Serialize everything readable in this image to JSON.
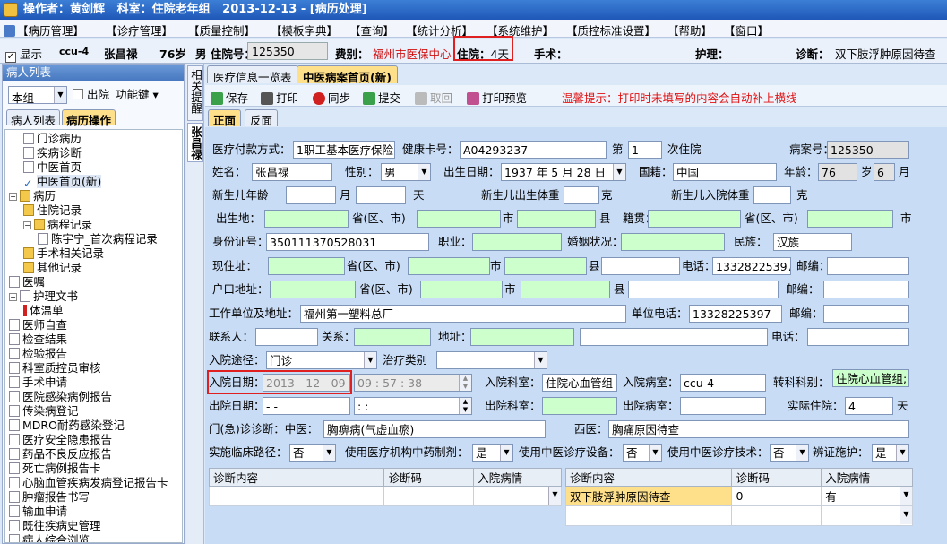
{
  "titlebar": {
    "text": "操作者：黄剑辉   科室：住院老年组   2013-12-13 - [病历处理]"
  },
  "menu": [
    "【病历管理】",
    "【诊疗管理】",
    "【质量控制】",
    "【模板字典】",
    "【查询】",
    "【统计分析】",
    "【系统维护】",
    "【质控标准设置】",
    "【帮助】",
    "【窗口】"
  ],
  "infobar": {
    "show_label": "显示",
    "bed": "ccu-4",
    "patient_name": "张昌禄",
    "age": "76岁",
    "gender_label": "男 住院号：",
    "inpatient_no": "125350",
    "fee_type_label": "费别：",
    "fee_type": "福州市医保中心",
    "stay_label": "住院：",
    "stay_days": "4天",
    "surgery_label": "手术：",
    "nursing_label": "护理：",
    "diagnosis_label": "诊断：",
    "diagnosis": "双下肢浮肿原因待查"
  },
  "left": {
    "header": "病人列表",
    "group": "本组",
    "discharge_label": "出院",
    "function_label": "功能键",
    "tabs": [
      "病人列表",
      "病历操作"
    ],
    "tree": [
      {
        "label": "门诊病历",
        "level": 1,
        "type": "doc"
      },
      {
        "label": "疾病诊断",
        "level": 1,
        "type": "doc"
      },
      {
        "label": "中医首页",
        "level": 1,
        "type": "doc"
      },
      {
        "label": "中医首页(新)",
        "level": 1,
        "type": "check"
      },
      {
        "label": "病历",
        "level": 0,
        "type": "folder",
        "pm": "−"
      },
      {
        "label": "住院记录",
        "level": 1,
        "type": "folder"
      },
      {
        "label": "病程记录",
        "level": 1,
        "type": "folder",
        "pm": "−"
      },
      {
        "label": "陈宇宁_首次病程记录",
        "level": 2,
        "type": "doc"
      },
      {
        "label": "手术相关记录",
        "level": 1,
        "type": "folder"
      },
      {
        "label": "其他记录",
        "level": 1,
        "type": "folder"
      },
      {
        "label": "医嘱",
        "level": 0,
        "type": "doc"
      },
      {
        "label": "护理文书",
        "level": 0,
        "type": "doc",
        "pm": "−"
      },
      {
        "label": "体温单",
        "level": 1,
        "type": "therm"
      },
      {
        "label": "医师自查",
        "level": 0,
        "type": "doc"
      },
      {
        "label": "检查结果",
        "level": 0,
        "type": "doc"
      },
      {
        "label": "检验报告",
        "level": 0,
        "type": "doc"
      },
      {
        "label": "科室质控员审核",
        "level": 0,
        "type": "doc"
      },
      {
        "label": "手术申请",
        "level": 0,
        "type": "doc"
      },
      {
        "label": "医院感染病例报告",
        "level": 0,
        "type": "doc"
      },
      {
        "label": "传染病登记",
        "level": 0,
        "type": "doc"
      },
      {
        "label": "MDRO耐药感染登记",
        "level": 0,
        "type": "doc"
      },
      {
        "label": "医疗安全隐患报告",
        "level": 0,
        "type": "doc"
      },
      {
        "label": "药品不良反应报告",
        "level": 0,
        "type": "doc"
      },
      {
        "label": "死亡病例报告卡",
        "level": 0,
        "type": "doc"
      },
      {
        "label": "心脑血管疾病发病登记报告卡",
        "level": 0,
        "type": "doc"
      },
      {
        "label": "肿瘤报告书写",
        "level": 0,
        "type": "doc"
      },
      {
        "label": "输血申请",
        "level": 0,
        "type": "doc"
      },
      {
        "label": "既往疾病史管理",
        "level": 0,
        "type": "doc"
      },
      {
        "label": "病人综合浏览",
        "level": 0,
        "type": "doc"
      }
    ]
  },
  "vtabs": [
    "相关提醒",
    "张昌禄"
  ],
  "main_tabs": [
    "医疗信息一览表",
    "中医病案首页(新)"
  ],
  "toolbar": {
    "save": "保存",
    "print": "打印",
    "sync": "同步",
    "submit": "提交",
    "withdraw": "取回",
    "print_preview": "打印预览",
    "tip": "温馨提示：打印时未填写的内容会自动补上横线"
  },
  "sub_tabs": [
    "正面",
    "反面"
  ],
  "form": {
    "pay_label": "医疗付款方式：",
    "pay": "1职工基本医疗保险",
    "card_label": "健康卡号：",
    "card": "A04293237",
    "times_pre": "第",
    "times": "1",
    "times_post": "次住院",
    "case_label": "病案号：",
    "case_no": "125350",
    "name_label": "姓名：",
    "name": "张昌禄",
    "sex_label": "性别：",
    "sex": "男",
    "dob_label": "出生日期：",
    "dob": "1937 年 5 月 28 日",
    "nation_label": "国籍：",
    "nation": "中国",
    "age_label": "年龄：",
    "age": "76",
    "age_unit": "岁",
    "age_month": "6",
    "month_unit": "月",
    "nb_age_label": "新生儿年龄",
    "month": "月",
    "day": "天",
    "nb_weight_label": "新生儿出生体重",
    "gram": "克",
    "nb_in_weight_label": "新生儿入院体重",
    "birthplace_label": "出生地：",
    "prov": "省(区、市)",
    "city": "市",
    "county": "县",
    "native_label": "籍贯：",
    "id_label": "身份证号：",
    "id_no": "350111370528031",
    "job_label": "职业：",
    "marital_label": "婚姻状况：",
    "ethnic_label": "民族：",
    "ethnic": "汉族",
    "addr_label": "现住址：",
    "phone_label": "电话：",
    "phone": "13328225397",
    "zip_label": "邮编：",
    "hukou_label": "户口地址：",
    "work_label": "工作单位及地址：",
    "work": "福州第一塑料总厂",
    "work_phone_label": "单位电话：",
    "work_phone": "13328225397",
    "contact_label": "联系人：",
    "relation_label": "关系：",
    "address_label": "地址：",
    "admit_route_label": "入院途径：",
    "admit_route": "门诊",
    "treat_type_label": "治疗类别",
    "admit_date_label": "入院日期：",
    "admit_date": "2013 - 12 - 09",
    "admit_time": "09 : 57 : 38",
    "admit_dept_label": "入院科室：",
    "admit_dept": "住院心血管组",
    "admit_ward_label": "入院病室：",
    "admit_ward": "ccu-4",
    "transfer_label": "转科科别：",
    "transfer": "住院心血管组;",
    "dis_date_label": "出院日期：",
    "dis_date": "-      -",
    "dis_time": ":      :",
    "dis_dept_label": "出院科室：",
    "dis_ward_label": "出院病室：",
    "actual_label": "实际住院：",
    "actual": "4",
    "actual_unit": "天",
    "op_diag_label": "门(急)诊诊断：中医：",
    "op_tcm": "胸痹病(气虚血瘀)",
    "western_label": "西医：",
    "western": "胸痛原因待查",
    "path_label": "实施临床路径：",
    "path": "否",
    "drug_label": "使用医疗机构中药制剂：",
    "drug": "是",
    "equip_label": "使用中医诊疗设备：",
    "equip": "否",
    "tech_label": "使用中医诊疗技术：",
    "tech": "否",
    "syn_label": "辨证施护：",
    "syn": "是"
  },
  "grid_left": {
    "headers": [
      "诊断内容",
      "诊断码",
      "入院病情"
    ],
    "rows": [
      [
        "",
        "",
        ""
      ]
    ]
  },
  "grid_right": {
    "headers": [
      "诊断内容",
      "诊断码",
      "入院病情"
    ],
    "rows": [
      [
        "双下肢浮肿原因待查",
        "0",
        "有"
      ],
      [
        "",
        "",
        ""
      ]
    ]
  }
}
